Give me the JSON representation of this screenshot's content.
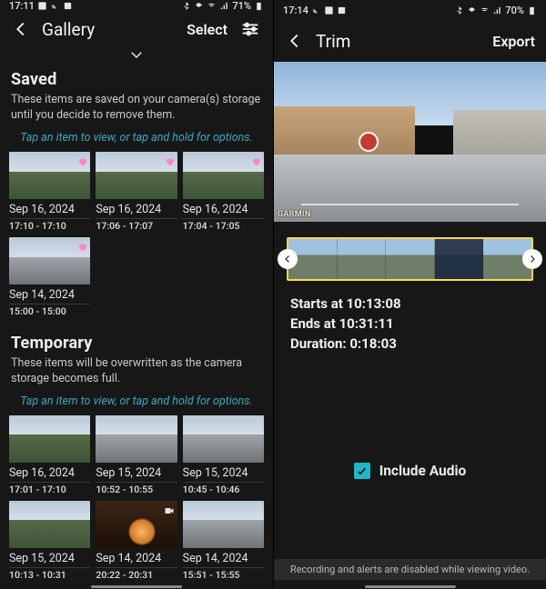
{
  "left": {
    "status": {
      "time": "17:11",
      "battery": "71%"
    },
    "appbar": {
      "title": "Gallery",
      "action": "Select"
    },
    "saved": {
      "title": "Saved",
      "desc": "These items are saved on your camera(s) storage until you decide to remove them.",
      "hint": "Tap an item to view, or tap and hold for options.",
      "items": [
        {
          "date": "Sep 16, 2024",
          "time": "17:10 - 17:10",
          "fav": true,
          "style": "grass"
        },
        {
          "date": "Sep 16, 2024",
          "time": "17:06 - 17:07",
          "fav": true,
          "style": "grass"
        },
        {
          "date": "Sep 16, 2024",
          "time": "17:04 - 17:05",
          "fav": true,
          "style": "grass"
        },
        {
          "date": "Sep 14, 2024",
          "time": "15:00 - 15:00",
          "fav": true,
          "style": "road"
        }
      ]
    },
    "temporary": {
      "title": "Temporary",
      "desc": "These items will be overwritten as the camera storage becomes full.",
      "hint": "Tap an item to view, or tap and hold for options.",
      "items": [
        {
          "date": "Sep 16, 2024",
          "time": "17:01 - 17:10",
          "style": "grass"
        },
        {
          "date": "Sep 15, 2024",
          "time": "10:52 - 10:55",
          "style": "road"
        },
        {
          "date": "Sep 15, 2024",
          "time": "10:45 - 10:46",
          "style": "road"
        },
        {
          "date": "Sep 15, 2024",
          "time": "10:13 - 10:31",
          "style": "grass"
        },
        {
          "date": "Sep 14, 2024",
          "time": "20:22 - 20:31",
          "style": "night",
          "video": true
        },
        {
          "date": "Sep 14, 2024",
          "time": "15:51 - 15:55",
          "style": "road"
        }
      ]
    }
  },
  "right": {
    "status": {
      "time": "17:14",
      "battery": "70%"
    },
    "appbar": {
      "title": "Trim",
      "action": "Export"
    },
    "preview_overlay": "GARMIN",
    "timeinfo": {
      "starts_lbl": "Starts at ",
      "starts": "10:13:08",
      "ends_lbl": "Ends at ",
      "ends": "10:31:11",
      "dur_lbl": "Duration: ",
      "dur": "0:18:03"
    },
    "include_audio": "Include Audio",
    "footnote": "Recording and alerts are disabled while viewing video."
  }
}
